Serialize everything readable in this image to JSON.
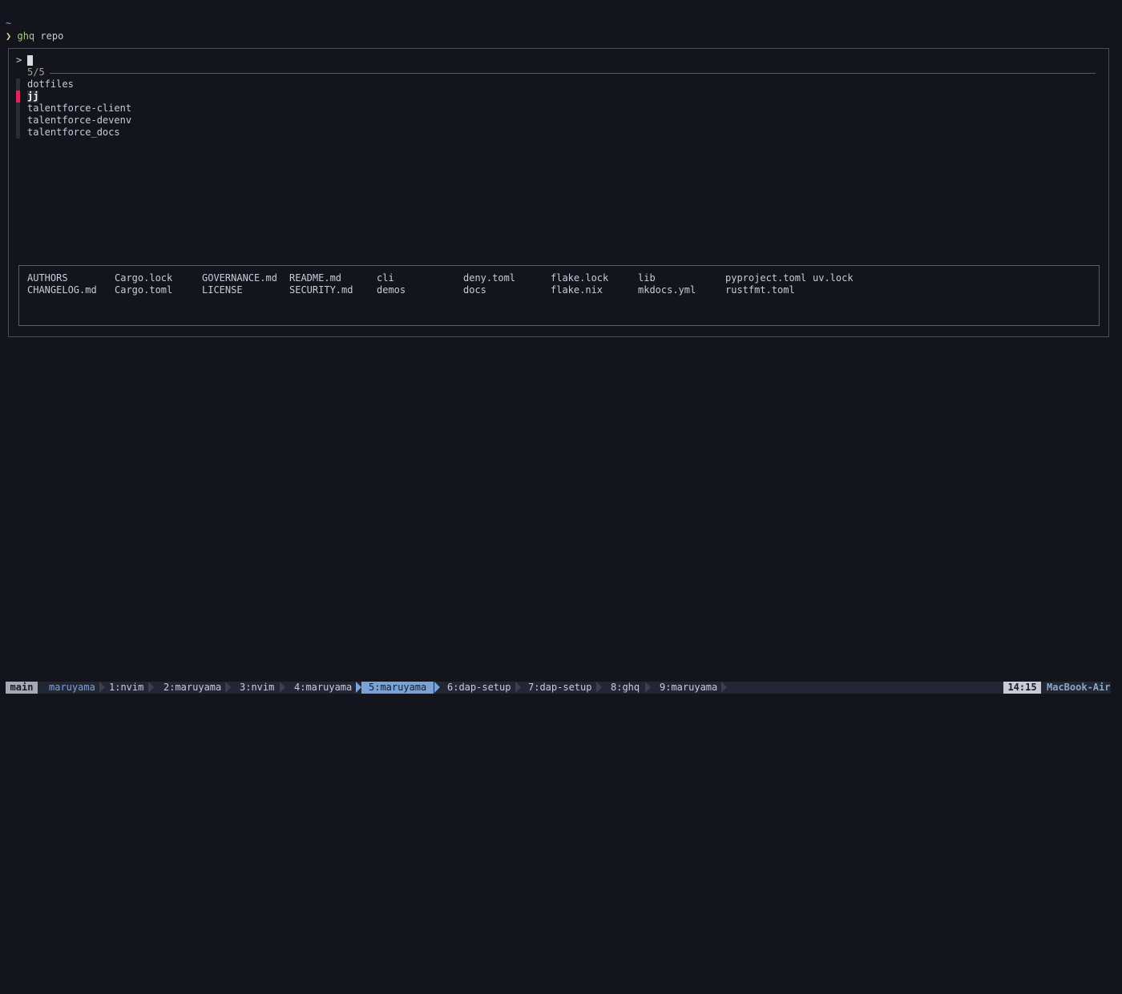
{
  "shell": {
    "cwd": "~",
    "prompt_symbol": "❯",
    "command": "ghq",
    "argument": "repo"
  },
  "fzf": {
    "query_prefix": ">",
    "query": "",
    "count": "5/5",
    "results": [
      {
        "label": "dotfiles",
        "selected": false
      },
      {
        "label": "jj",
        "selected": true
      },
      {
        "label": "talentforce-client",
        "selected": false
      },
      {
        "label": "talentforce-devenv",
        "selected": false
      },
      {
        "label": "talentforce_docs",
        "selected": false
      }
    ],
    "preview": {
      "rows": [
        [
          "AUTHORS",
          "Cargo.lock",
          "GOVERNANCE.md",
          "README.md",
          "cli",
          "deny.toml",
          "flake.lock",
          "lib",
          "pyproject.toml",
          "uv.lock"
        ],
        [
          "CHANGELOG.md",
          "Cargo.toml",
          "LICENSE",
          "SECURITY.md",
          "demos",
          "docs",
          "flake.nix",
          "mkdocs.yml",
          "rustfmt.toml"
        ]
      ]
    }
  },
  "tmux": {
    "session": "main",
    "user": "maruyama",
    "windows": [
      {
        "label": "1:nvim",
        "active": false
      },
      {
        "label": "2:maruyama",
        "active": false
      },
      {
        "label": "3:nvim",
        "active": false
      },
      {
        "label": "4:maruyama",
        "active": false
      },
      {
        "label": "5:maruyama",
        "active": true
      },
      {
        "label": "6:dap-setup",
        "active": false
      },
      {
        "label": "7:dap-setup",
        "active": false
      },
      {
        "label": "8:ghq",
        "active": false
      },
      {
        "label": "9:maruyama",
        "active": false
      }
    ],
    "time": "14:15",
    "host": "MacBook-Air"
  },
  "colors": {
    "background": "#13141c",
    "selection_marker": "#e0245e",
    "active_window": "#7aa2d6",
    "prompt_symbol": "#e5d77a",
    "command": "#a8c98a"
  }
}
